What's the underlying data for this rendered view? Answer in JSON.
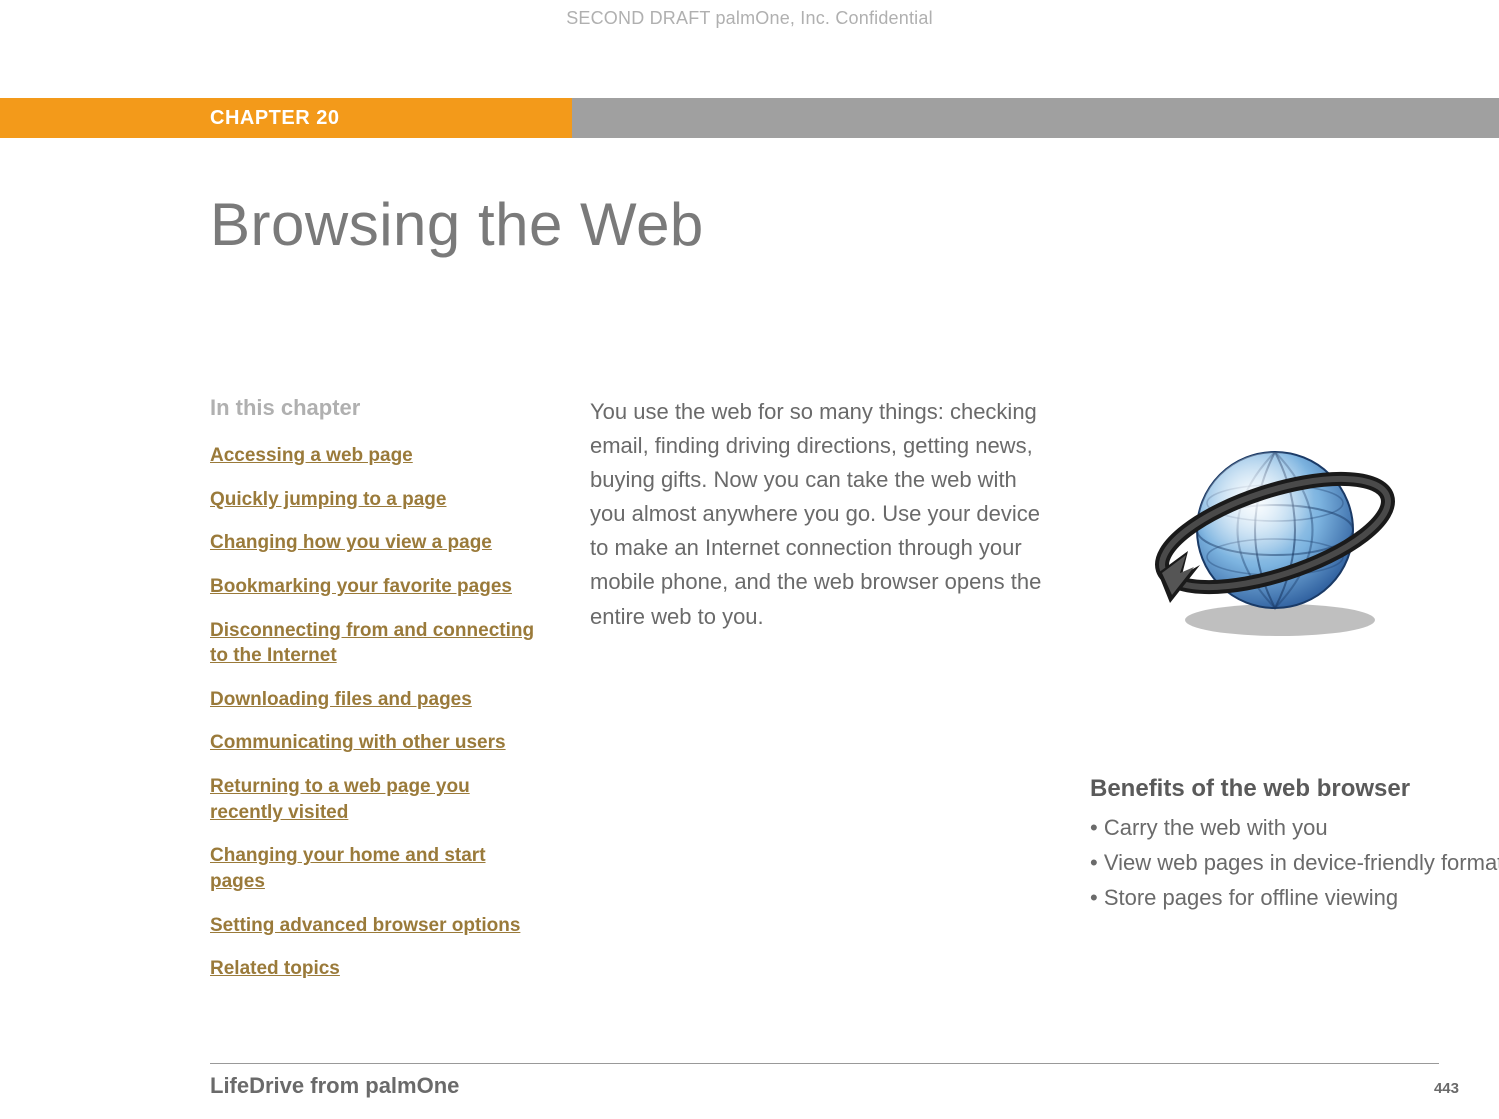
{
  "confidential": "SECOND DRAFT palmOne, Inc.  Confidential",
  "chapter": {
    "label": "CHAPTER 20"
  },
  "title": "Browsing the Web",
  "sidebar": {
    "heading": "In this chapter",
    "items": [
      "Accessing a web page",
      "Quickly jumping to a page",
      "Changing how you view a page",
      "Bookmarking your favorite pages",
      "Disconnecting from and connecting to the Internet",
      "Downloading files and pages",
      "Communicating with other users",
      "Returning to a web page you recently visited",
      "Changing your home and start pages",
      "Setting advanced browser options",
      "Related topics"
    ]
  },
  "intro": "You use the web for so many things: checking email, finding driving directions, getting news, buying gifts. Now you can take the web with you almost anywhere you go. Use your device to make an Internet connection through your mobile phone, and the web browser opens the entire web to you.",
  "benefits": {
    "heading": "Benefits of the web browser",
    "items": [
      "Carry the web with you",
      "View web pages in device-friendly format",
      "Store pages for offline viewing"
    ]
  },
  "footer": {
    "product": "LifeDrive from palmOne",
    "page": "443"
  }
}
